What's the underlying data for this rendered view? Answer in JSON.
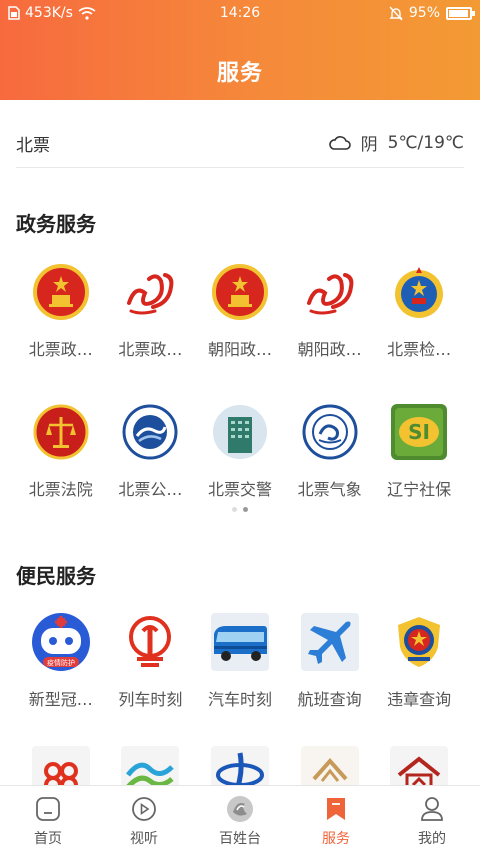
{
  "status_bar": {
    "speed": "453K/s",
    "time": "14:26",
    "battery": "95%"
  },
  "header": {
    "title": "服务"
  },
  "weather": {
    "city": "北票",
    "condition": "阴",
    "temperature": "5℃/19℃"
  },
  "sections": {
    "gov": {
      "title": "政务服务",
      "items": [
        {
          "label": "北票政…",
          "icon": "national-emblem-icon"
        },
        {
          "label": "北票政…",
          "icon": "swirl-logo-icon"
        },
        {
          "label": "朝阳政…",
          "icon": "national-emblem-icon"
        },
        {
          "label": "朝阳政…",
          "icon": "swirl-logo-icon"
        },
        {
          "label": "北票检…",
          "icon": "procuratorate-emblem-icon"
        },
        {
          "label": "北票法院",
          "icon": "court-emblem-icon"
        },
        {
          "label": "北票公…",
          "icon": "public-security-badge-icon"
        },
        {
          "label": "北票交警",
          "icon": "traffic-police-building-icon"
        },
        {
          "label": "北票气象",
          "icon": "meteorology-badge-icon"
        },
        {
          "label": "辽宁社保",
          "icon": "social-security-icon"
        }
      ]
    },
    "convenience": {
      "title": "便民服务",
      "items": [
        {
          "label": "新型冠…",
          "icon": "epidemic-robot-icon",
          "badge": "疫情防护"
        },
        {
          "label": "列车时刻",
          "icon": "railway-logo-icon"
        },
        {
          "label": "汽车时刻",
          "icon": "bus-icon"
        },
        {
          "label": "航班查询",
          "icon": "airplane-icon"
        },
        {
          "label": "违章查询",
          "icon": "police-emblem-icon"
        }
      ],
      "partial_icons": [
        "china-unicom-icon",
        "china-mobile-icon",
        "china-telecom-icon",
        "home-logo-icon",
        "bank-logo-icon"
      ]
    }
  },
  "tabbar": {
    "items": [
      {
        "label": "首页",
        "icon": "home-icon"
      },
      {
        "label": "视听",
        "icon": "play-icon"
      },
      {
        "label": "百姓台",
        "icon": "station-logo-icon"
      },
      {
        "label": "服务",
        "icon": "bookmark-icon",
        "active": true
      },
      {
        "label": "我的",
        "icon": "user-icon"
      }
    ]
  },
  "colors": {
    "accent": "#f0643a",
    "header_start": "#f76a3e",
    "header_end": "#f39a34",
    "emblem_red": "#d7261e",
    "gold": "#f2c230"
  }
}
